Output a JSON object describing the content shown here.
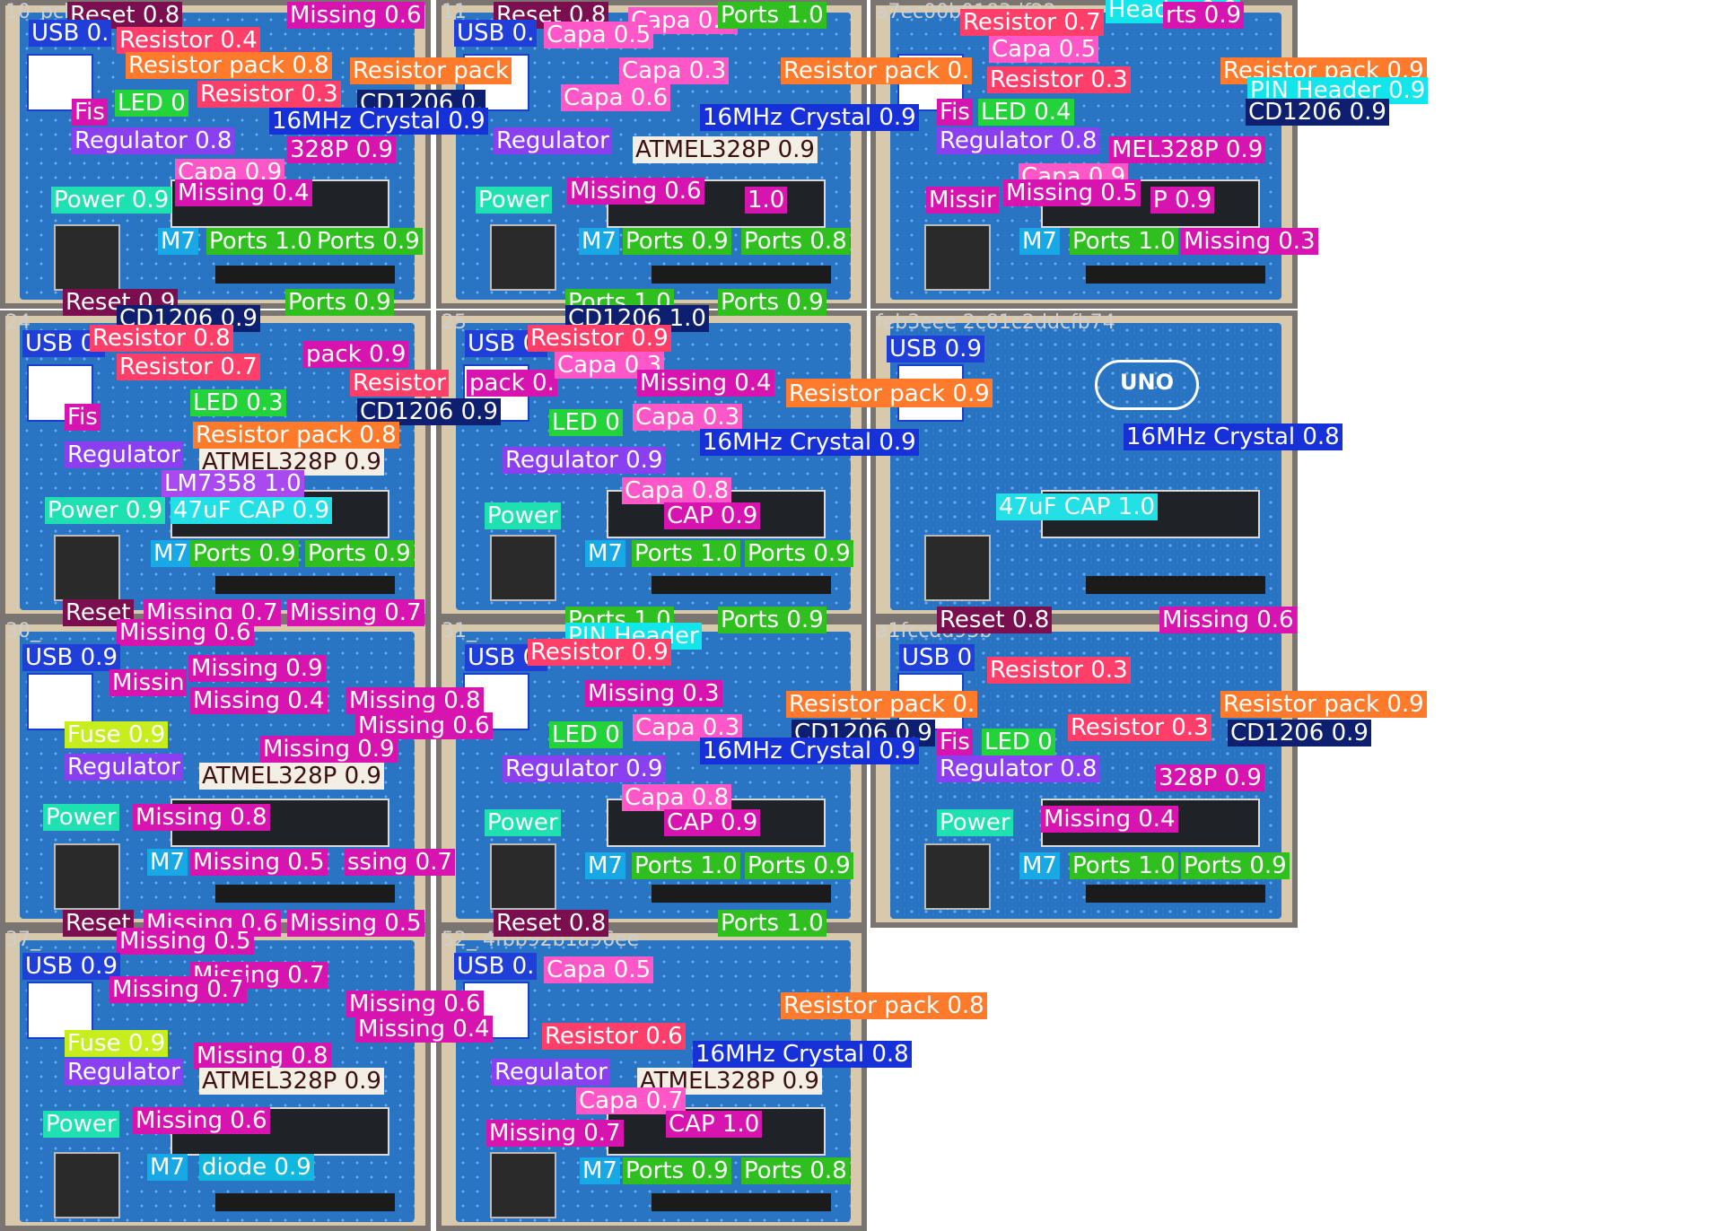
{
  "colors": {
    "Reset": "#7a0e4e",
    "USB": "#1f3fd8",
    "Resistor": "#ff3f6a",
    "Resistor pack": "#ff7a2a",
    "Capa": "#ff56c8",
    "LED": "#22d43a",
    "Fuse": "#c6ee1c",
    "Regulator": "#8a3ff0",
    "16MHz Crystal": "#1631d8",
    "CD1206": "#0d1f6e",
    "ATMEL328P": "#f3eee6",
    "Power": "#1ee0b0",
    "Missing": "#d814b0",
    "M7": "#18a8e6",
    "Ports": "#2fc01f",
    "PIN Header": "#12e6ea",
    "47uF CAP": "#22e0e6",
    "LM7358": "#a94af0",
    "diode": "#10b8e0",
    "SSC": "#c6ee1c",
    "Header": "#12e6ea"
  },
  "tiles": [
    {
      "title": "10_pcb",
      "dets": [
        [
          "Reset 0.8",
          75,
          30
        ],
        [
          "Missing 0.6",
          320,
          30
        ],
        [
          "USB 0.",
          32,
          50
        ],
        [
          "Resistor 0.4",
          130,
          58
        ],
        [
          "Resistor pack 0.8",
          140,
          86
        ],
        [
          "Resistor pack",
          390,
          92
        ],
        [
          "Resistor 0.3",
          220,
          118
        ],
        [
          "CD1206 0.",
          398,
          128
        ],
        [
          "LED 0",
          128,
          128
        ],
        [
          "Fis",
          80,
          138
        ],
        [
          "16MHz Crystal 0.9",
          300,
          148
        ],
        [
          "Regulator 0.8",
          80,
          170
        ],
        [
          "328P 0.9",
          320,
          180
        ],
        [
          "Capa 0.9",
          195,
          205
        ],
        [
          "Missing 0.4",
          195,
          228
        ],
        [
          "Power 0.9",
          57,
          236
        ],
        [
          "M7",
          176,
          282
        ],
        [
          "Ports 1.0",
          230,
          282
        ],
        [
          "Ports 0.9",
          350,
          282
        ]
      ]
    },
    {
      "title": "11_",
      "dets": [
        [
          "Reset 0.8",
          550,
          30
        ],
        [
          "Capa 0.9",
          700,
          36
        ],
        [
          "Ports 1.0",
          800,
          30
        ],
        [
          "USB 0.",
          506,
          50
        ],
        [
          "Capa 0.5",
          606,
          52
        ],
        [
          "Resistor pack 0.",
          870,
          92
        ],
        [
          "Capa 0.3",
          690,
          92
        ],
        [
          "Capa 0.6",
          625,
          122
        ],
        [
          "16MHz Crystal 0.9",
          780,
          144
        ],
        [
          "Regulator",
          550,
          170
        ],
        [
          "ATMEL328P 0.9",
          705,
          180
        ],
        [
          "Missing 0.6",
          632,
          226
        ],
        [
          "Power",
          530,
          236
        ],
        [
          "1.0",
          830,
          236
        ],
        [
          "M7",
          645,
          282
        ],
        [
          "Ports 0.9",
          694,
          282
        ],
        [
          "Ports 0.8",
          826,
          282
        ]
      ]
    },
    {
      "title": "a7ec00b0183df22",
      "dets": [
        [
          "Resistor 0.7",
          1070,
          38
        ],
        [
          "Header 0.9",
          1232,
          24
        ],
        [
          "rts 0.9",
          1296,
          30
        ],
        [
          "Capa 0.5",
          1102,
          68
        ],
        [
          "Resistor pack 0.9",
          1360,
          92
        ],
        [
          "Resistor 0.3",
          1100,
          102
        ],
        [
          "PIN Header 0.9",
          1390,
          114
        ],
        [
          "Fis",
          1044,
          138
        ],
        [
          "LED 0.4",
          1090,
          138
        ],
        [
          "CD1206 0.9",
          1388,
          138
        ],
        [
          "Regulator 0.8",
          1044,
          170
        ],
        [
          "MEL328P 0.9",
          1236,
          180
        ],
        [
          "Capa 0.9",
          1135,
          210
        ],
        [
          "Missing 0.5",
          1118,
          228
        ],
        [
          "Missir",
          1032,
          236
        ],
        [
          "P 0.9",
          1282,
          236
        ],
        [
          "M7",
          1136,
          282
        ],
        [
          "Ports 1.0",
          1192,
          282
        ],
        [
          "Missing 0.3",
          1316,
          282
        ]
      ]
    },
    {
      "title": "24_",
      "dets": [
        [
          "Reset 0.9",
          70,
          350
        ],
        [
          "Ports 0.9",
          318,
          350
        ],
        [
          "CD1206 0.9",
          130,
          368
        ],
        [
          "USB 0.",
          25,
          396
        ],
        [
          "Resistor 0.8",
          100,
          390
        ],
        [
          "pack 0.9",
          338,
          408
        ],
        [
          "Resistor 0.7",
          130,
          422
        ],
        [
          "Resistor",
          390,
          440
        ],
        [
          "pack 0.",
          520,
          440
        ],
        [
          "LED 0.3",
          212,
          462
        ],
        [
          "CD1206 0.9",
          398,
          472
        ],
        [
          "Fis",
          72,
          478
        ],
        [
          "Resistor pack 0.8",
          215,
          498
        ],
        [
          "Regulator",
          72,
          520
        ],
        [
          "ATMEL328P 0.9",
          222,
          528
        ],
        [
          "LM7358 1.0",
          180,
          552
        ],
        [
          "Power 0.9",
          50,
          582
        ],
        [
          "47uF CAP 0.9",
          190,
          582
        ],
        [
          "M7",
          168,
          630
        ],
        [
          "Ports 0.9",
          212,
          630
        ],
        [
          "Ports 0.9",
          340,
          630
        ]
      ]
    },
    {
      "title": "25_",
      "dets": [
        [
          "Ports 1.0",
          630,
          350
        ],
        [
          "Ports 0.9",
          800,
          350
        ],
        [
          "CD1206 1.0",
          630,
          368
        ],
        [
          "USB 0.",
          518,
          396
        ],
        [
          "Resistor 0.9",
          588,
          390
        ],
        [
          "Capa 0.3",
          618,
          420
        ],
        [
          "Missing 0.4",
          710,
          440
        ],
        [
          "Resistor pack 0.9",
          876,
          450
        ],
        [
          "Capa 0.3",
          705,
          478
        ],
        [
          "LED 0",
          612,
          484
        ],
        [
          "16MHz Crystal 0.9",
          780,
          506
        ],
        [
          "Regulator 0.9",
          560,
          526
        ],
        [
          "Capa 0.8",
          693,
          560
        ],
        [
          "CAP 0.9",
          740,
          588
        ],
        [
          "Power",
          540,
          588
        ],
        [
          "M7",
          652,
          630
        ],
        [
          "Ports 1.0",
          704,
          630
        ],
        [
          "Ports 0.9",
          830,
          630
        ]
      ]
    },
    {
      "title": "feb3eee 2c81c2ddcfb74",
      "dets": [
        [
          "USB 0.9",
          988,
          402
        ],
        [
          "Resistor pack 0.9",
          876,
          452
        ],
        [
          "16MHz Crystal 0.8",
          1252,
          500
        ],
        [
          "47uF CAP 1.0",
          1110,
          578
        ]
      ]
    },
    {
      "title": "30_",
      "dets": [
        [
          "Reset",
          70,
          696
        ],
        [
          "Missing 0.7",
          160,
          696
        ],
        [
          "Missing 0.7",
          320,
          696
        ],
        [
          "Missing 0.6",
          130,
          718
        ],
        [
          "USB 0.9",
          25,
          746
        ],
        [
          "Missing 0.9",
          210,
          758
        ],
        [
          "Missing 0.4",
          212,
          794
        ],
        [
          "Missin",
          122,
          774
        ],
        [
          "Missing 0.8",
          386,
          794
        ],
        [
          "Missing 0.6",
          396,
          822
        ],
        [
          "Fuse 0.9",
          72,
          832
        ],
        [
          "Missing 0.9",
          290,
          848
        ],
        [
          "Regulator",
          72,
          868
        ],
        [
          "ATMEL328P 0.9",
          222,
          878
        ],
        [
          "Power",
          48,
          924
        ],
        [
          "Missing 0.8",
          148,
          924
        ],
        [
          "M7",
          164,
          974
        ],
        [
          "Missing 0.5",
          212,
          974
        ],
        [
          "ssing 0.7",
          384,
          974
        ]
      ]
    },
    {
      "title": "31_",
      "dets": [
        [
          "Ports 1.0",
          630,
          704
        ],
        [
          "Ports 0.9",
          800,
          704
        ],
        [
          "PIN Header",
          630,
          722
        ],
        [
          "USB 0.",
          518,
          746
        ],
        [
          "Resistor 0.9",
          588,
          740
        ],
        [
          "Missing 0.3",
          652,
          786
        ],
        [
          "Resistor pack 0.",
          876,
          798
        ],
        [
          "Capa 0.3",
          705,
          824
        ],
        [
          "CD1206 0.9",
          882,
          830
        ],
        [
          "LED 0",
          612,
          832
        ],
        [
          "16MHz Crystal 0.9",
          780,
          850
        ],
        [
          "Regulator 0.9",
          560,
          870
        ],
        [
          "Capa 0.8",
          693,
          902
        ],
        [
          "CAP 0.9",
          740,
          930
        ],
        [
          "Power",
          540,
          930
        ],
        [
          "M7",
          652,
          978
        ],
        [
          "Ports 1.0",
          704,
          978
        ],
        [
          "Ports 0.9",
          830,
          978
        ]
      ]
    },
    {
      "title": "a1fccdd93b",
      "dets": [
        [
          "Reset 0.8",
          1044,
          704
        ],
        [
          "Missing 0.6",
          1292,
          704
        ],
        [
          "USB 0",
          1002,
          746
        ],
        [
          "Resistor 0.3",
          1100,
          760
        ],
        [
          "Resistor pack 0.9",
          1360,
          798
        ],
        [
          "Resistor 0.3",
          1190,
          824
        ],
        [
          "CD1206 0.9",
          1368,
          830
        ],
        [
          "Fis",
          1044,
          840
        ],
        [
          "LED 0",
          1094,
          840
        ],
        [
          "Regulator 0.8",
          1044,
          870
        ],
        [
          "328P 0.9",
          1288,
          880
        ],
        [
          "Missing 0.4",
          1160,
          926
        ],
        [
          "Power",
          1044,
          930
        ],
        [
          "M7",
          1136,
          978
        ],
        [
          "Ports 1.0",
          1192,
          978
        ],
        [
          "Ports 0.9",
          1316,
          978
        ]
      ]
    },
    {
      "title": "37_",
      "dets": [
        [
          "Reset",
          70,
          1042
        ],
        [
          "Missing 0.6",
          160,
          1042
        ],
        [
          "Missing 0.5",
          320,
          1042
        ],
        [
          "Missing 0.5",
          130,
          1062
        ],
        [
          "USB 0.9",
          25,
          1090
        ],
        [
          "Missing 0.7",
          212,
          1100
        ],
        [
          "Missing 0.7",
          122,
          1116
        ],
        [
          "Missing 0.6",
          386,
          1132
        ],
        [
          "Missing 0.4",
          396,
          1160
        ],
        [
          "Fuse 0.9",
          72,
          1176
        ],
        [
          "Missing 0.8",
          216,
          1190
        ],
        [
          "Regulator",
          72,
          1208
        ],
        [
          "ATMEL328P 0.9",
          222,
          1218
        ],
        [
          "Power",
          48,
          1266
        ],
        [
          "Missing 0.6",
          148,
          1262
        ],
        [
          "M7",
          164,
          1314
        ],
        [
          "diode 0.9",
          222,
          1314
        ]
      ]
    },
    {
      "title": "52_ 4fbb92b1a96ee",
      "dets": [
        [
          "Reset 0.8",
          550,
          1042
        ],
        [
          "Ports 1.0",
          800,
          1042
        ],
        [
          "USB 0.",
          506,
          1090
        ],
        [
          "Capa 0.5",
          606,
          1094
        ],
        [
          "Resistor pack 0.8",
          870,
          1134
        ],
        [
          "Resistor 0.6",
          604,
          1168
        ],
        [
          "16MHz Crystal 0.8",
          772,
          1188
        ],
        [
          "Regulator",
          548,
          1208
        ],
        [
          "ATMEL328P 0.9",
          710,
          1218
        ],
        [
          "Capa 0.7",
          642,
          1240
        ],
        [
          "CAP 1.0",
          742,
          1266
        ],
        [
          "Missing 0.7",
          542,
          1276
        ],
        [
          "M7",
          646,
          1318
        ],
        [
          "Ports 0.9",
          694,
          1318
        ],
        [
          "Ports 0.8",
          826,
          1318
        ]
      ]
    }
  ]
}
